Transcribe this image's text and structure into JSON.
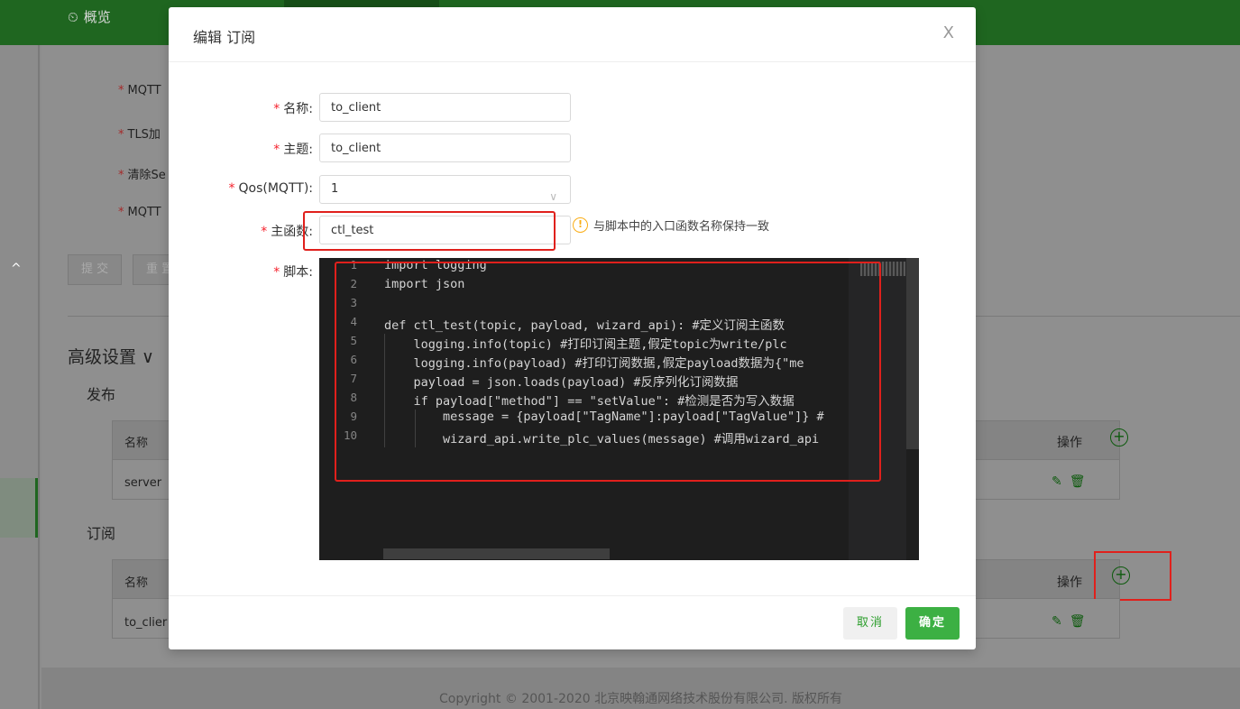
{
  "background": {
    "nav_overview_label": "概览",
    "form_labels": [
      "MQTT",
      "TLS加",
      "清除Se",
      "MQTT"
    ],
    "submit_label": "提 交",
    "reset_label": "重 置",
    "advanced_settings": "高级设置 ∨",
    "publish_title": "发布",
    "subscribe_title": "订阅",
    "col_name": "名称",
    "col_ops": "操作",
    "publish_rows": [
      "server"
    ],
    "subscribe_rows": [
      "to_clier"
    ],
    "copyright": "Copyright © 2001-2020 北京映翰通网络技术股份有限公司. 版权所有"
  },
  "modal": {
    "title": "编辑 订阅",
    "close": "X",
    "fields": {
      "name_label": "名称:",
      "name_value": "to_client",
      "topic_label": "主题:",
      "topic_value": "to_client",
      "qos_label": "Qos(MQTT):",
      "qos_value": "1",
      "func_label": "主函数:",
      "func_value": "ctl_test",
      "func_hint": "与脚本中的入口函数名称保持一致",
      "script_label": "脚本:"
    },
    "code_lines": [
      "import logging",
      "import json",
      "",
      "def ctl_test(topic, payload, wizard_api): #定义订阅主函数",
      "    logging.info(topic) #打印订阅主题,假定topic为write/plc",
      "    logging.info(payload) #打印订阅数据,假定payload数据为{\"me",
      "    payload = json.loads(payload) #反序列化订阅数据",
      "    if payload[\"method\"] == \"setValue\": #检测是否为写入数据",
      "        message = {payload[\"TagName\"]:payload[\"TagValue\"]} #",
      "        wizard_api.write_plc_values(message) #调用wizard_api"
    ],
    "line_numbers": [
      "1",
      "2",
      "3",
      "4",
      "5",
      "6",
      "7",
      "8",
      "9",
      "10"
    ],
    "cancel_label": "取消",
    "ok_label": "确定"
  }
}
